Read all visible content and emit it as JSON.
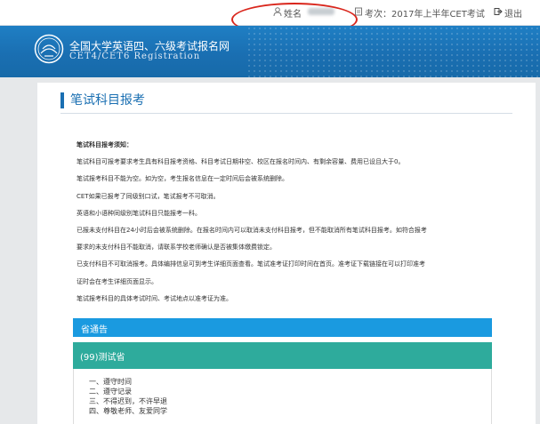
{
  "topbar": {
    "name_label": "姓名",
    "exam_label": "考次：2017年上半年CET考试",
    "exit_label": "退出"
  },
  "brand": {
    "title_cn": "全国大学英语四、六级考试报名网",
    "title_en": "CET4/CET6  Registration"
  },
  "section": {
    "title": "笔试科目报考"
  },
  "notice": {
    "heading": "笔试科目报考须知：",
    "lines": [
      "笔试科目可报考要求考生具有科目报考资格、科目考试日期非空、校区在报名时间内、有剩余容量、费用已设且大于0。",
      "笔试报考科目不能为空。如为空，考生报名信息在一定时间后会被系统删除。",
      "CET如果已报考了同级别口试，笔试报考不可取消。",
      "英语和小语种同级别笔试科目只能报考一科。",
      "已报未支付科目在24小时后会被系统删除。在报名时间内可以取消未支付科目报考，但不能取消所有笔试科目报考。如符合报考",
      "要求的未支付科目不能取消，请联系学校老师确认是否被集体缴费锁定。",
      "已支付科目不可取消报考。具体编排信息可到考生详细页面查看。笔试准考证打印时间在首页。准考证下载链接在可以打印准考",
      "证时会在考生详细页面显示。",
      "笔试报考科目的具体考试时间、考试地点以准考证为准。"
    ]
  },
  "province_notice": {
    "header": "省通告",
    "name": "(99)测试省",
    "rules": [
      "一、遵守时间",
      "二、遵守记录",
      "三、不得迟到，不许早退",
      "四、尊敬老师、友爱同学"
    ]
  },
  "colors": {
    "brand_blue": "#1a6fb2",
    "notice_header": "#1a9ae0",
    "province_teal": "#2eab9c",
    "annotation_red": "#d9261c"
  },
  "icons": {
    "user": "user-icon",
    "exam": "exam-icon",
    "exit": "exit-icon",
    "emblem": "emblem-icon"
  }
}
